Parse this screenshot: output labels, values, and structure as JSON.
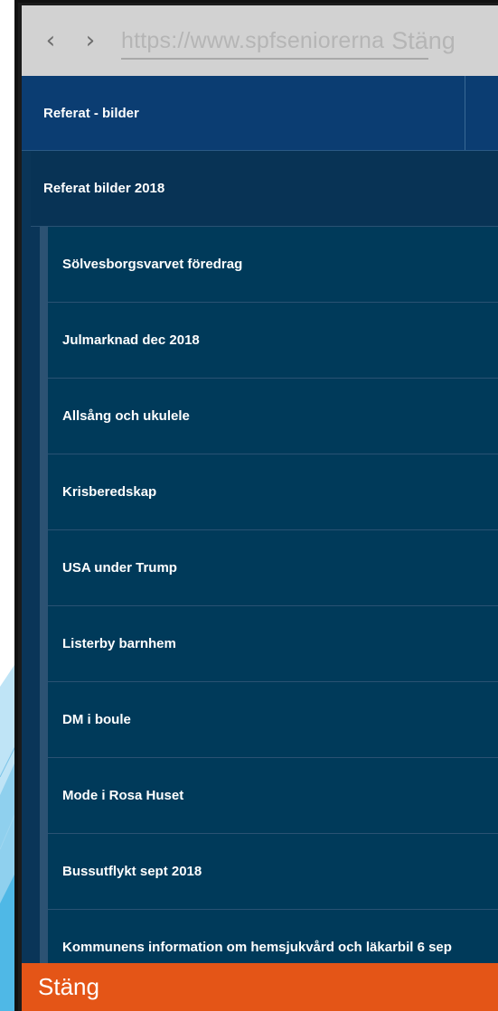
{
  "browser": {
    "url": "https://www.spfseniorerna",
    "close_label": "Stäng",
    "back_icon": "chevron-left-icon",
    "forward_icon": "chevron-right-icon"
  },
  "menu": {
    "top_item": "Referat - bilder",
    "section": "Referat bilder 2018",
    "items": [
      "Sölvesborgsvarvet föredrag",
      "Julmarknad dec 2018",
      "Allsång och ukulele",
      "Krisberedskap",
      "USA under Trump",
      "Listerby barnhem",
      "DM i boule",
      "Mode i Rosa Huset",
      "Bussutflykt sept 2018",
      "Kommunens information om hemsjukvård och läkarbil 6 sep"
    ]
  },
  "footer": {
    "close_label": "Stäng"
  },
  "colors": {
    "menu_bg": "#0a3558",
    "top_item_bg": "#0b3d72",
    "close_bar": "#e45517"
  }
}
